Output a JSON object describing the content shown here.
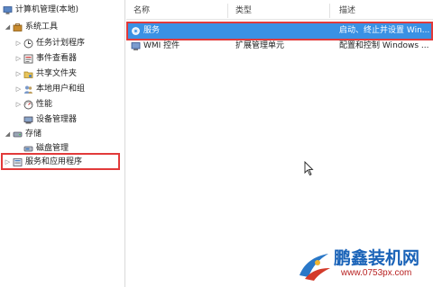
{
  "tree": {
    "root": "计算机管理(本地)",
    "system_tools": "系统工具",
    "task_scheduler": "任务计划程序",
    "event_viewer": "事件查看器",
    "shared_folders": "共享文件夹",
    "local_users": "本地用户和组",
    "performance": "性能",
    "device_manager": "设备管理器",
    "storage": "存储",
    "disk_management": "磁盘管理",
    "services_apps": "服务和应用程序"
  },
  "columns": {
    "name": "名称",
    "type": "类型",
    "desc": "描述"
  },
  "rows": [
    {
      "name": "服务",
      "type": "",
      "desc": "启动、终止并设置 Win..."
    },
    {
      "name": "WMI 控件",
      "type": "扩展管理单元",
      "desc": "配置和控制 Windows ..."
    }
  ],
  "watermark": {
    "brand": "鹏鑫装机网",
    "url": "www.0753px.com"
  },
  "colors": {
    "selection": "#3a91e4",
    "highlight": "#e23a3a",
    "brand": "#1a63b8"
  }
}
